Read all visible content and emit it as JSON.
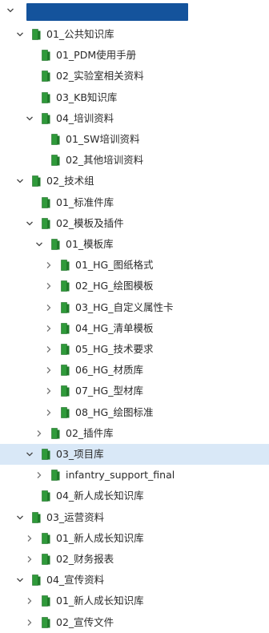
{
  "colors": {
    "folder_green": "#2f9a3a",
    "selected_bg": "#d9e8f7",
    "redaction": "#14539c",
    "chevron": "#444444"
  },
  "icons": {
    "expanded": "chevron-down-icon",
    "collapsed": "chevron-right-icon",
    "folder": "green-folder-icon"
  },
  "tree": {
    "root": {
      "expanded": true,
      "label_redacted": true
    },
    "rows": [
      {
        "label": "01_公共知识库",
        "expanded": true
      },
      {
        "label": "01_PDM使用手册"
      },
      {
        "label": "02_实验室相关资料"
      },
      {
        "label": "03_KB知识库"
      },
      {
        "label": "04_培训资料",
        "expanded": true
      },
      {
        "label": "01_SW培训资料"
      },
      {
        "label": "02_其他培训资料"
      },
      {
        "label": "02_技术组",
        "expanded": true
      },
      {
        "label": "01_标准件库"
      },
      {
        "label": "02_模板及插件",
        "expanded": true
      },
      {
        "label": "01_模板库",
        "expanded": true
      },
      {
        "label": "01_HG_图纸格式"
      },
      {
        "label": "02_HG_绘图模板"
      },
      {
        "label": "03_HG_自定义属性卡"
      },
      {
        "label": "04_HG_清单模板"
      },
      {
        "label": "05_HG_技术要求"
      },
      {
        "label": "06_HG_材质库"
      },
      {
        "label": "07_HG_型材库"
      },
      {
        "label": "08_HG_绘图标准"
      },
      {
        "label": "02_插件库"
      },
      {
        "label": "03_项目库",
        "expanded": true,
        "selected": true
      },
      {
        "label": "infantry_support_final"
      },
      {
        "label": "04_新人成长知识库"
      },
      {
        "label": "03_运营资料",
        "expanded": true
      },
      {
        "label": "01_新人成长知识库"
      },
      {
        "label": "02_财务报表"
      },
      {
        "label": "04_宣传资料",
        "expanded": true
      },
      {
        "label": "01_新人成长知识库"
      },
      {
        "label": "02_宣传文件"
      }
    ]
  }
}
